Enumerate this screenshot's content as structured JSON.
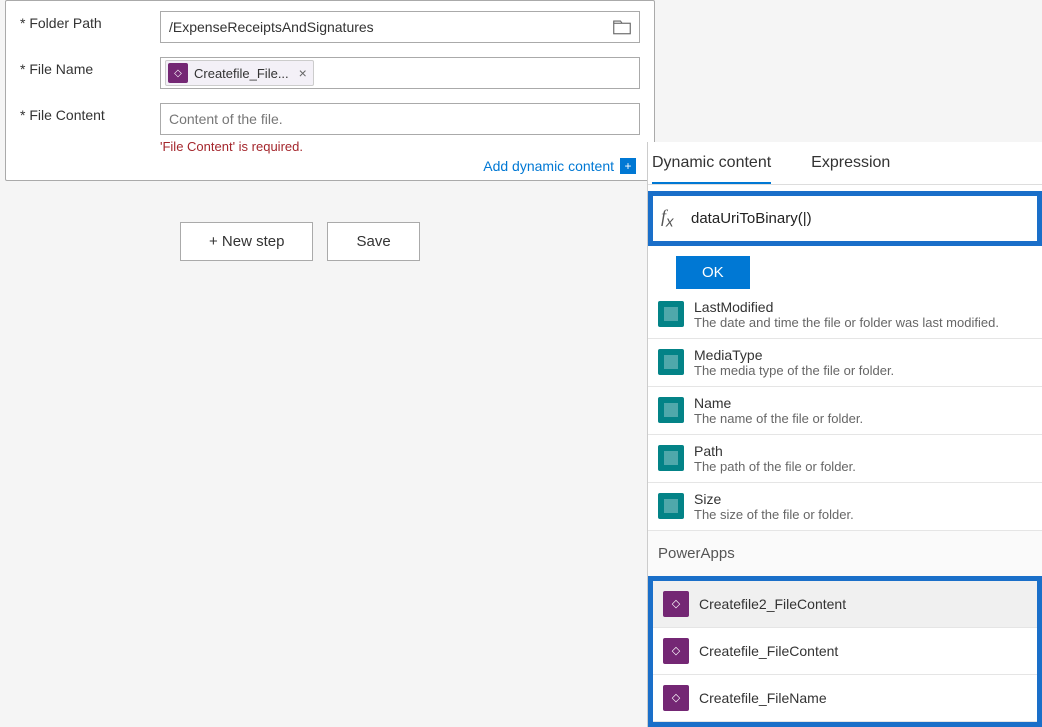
{
  "form": {
    "folderPath": {
      "label": "Folder Path",
      "value": "/ExpenseReceiptsAndSignatures"
    },
    "fileName": {
      "label": "File Name",
      "token": "Createfile_File..."
    },
    "fileContent": {
      "label": "File Content",
      "placeholder": "Content of the file.",
      "error": "'File Content' is required."
    },
    "addDynamic": "Add dynamic content"
  },
  "buttons": {
    "newStep": "+ New step",
    "save": "Save"
  },
  "panel": {
    "tabs": {
      "dynamic": "Dynamic content",
      "expression": "Expression"
    },
    "fx": "dataUriToBinary(|)",
    "ok": "OK",
    "items": [
      {
        "title": "LastModified",
        "desc": "The date and time the file or folder was last modified."
      },
      {
        "title": "MediaType",
        "desc": "The media type of the file or folder."
      },
      {
        "title": "Name",
        "desc": "The name of the file or folder."
      },
      {
        "title": "Path",
        "desc": "The path of the file or folder."
      },
      {
        "title": "Size",
        "desc": "The size of the file or folder."
      }
    ],
    "section": "PowerApps",
    "paItems": [
      "Createfile2_FileContent",
      "Createfile_FileContent",
      "Createfile_FileName"
    ]
  }
}
